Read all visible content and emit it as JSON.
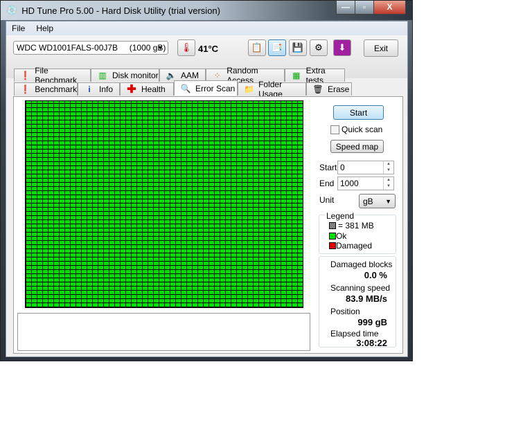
{
  "window": {
    "title": "HD Tune Pro 5.00 - Hard Disk Utility (trial version)",
    "minimize": "—",
    "maximize": "▫",
    "close": "X"
  },
  "menu": {
    "file": "File",
    "help": "Help"
  },
  "toolbar": {
    "drive": "WDC WD1001FALS-00J7B     (1000 gB)",
    "temperature": "41°C",
    "exit": "Exit"
  },
  "tabs_top": [
    "File Benchmark",
    "Disk monitor",
    "AAM",
    "Random Access",
    "Extra tests"
  ],
  "tabs_bottom": [
    "Benchmark",
    "Info",
    "Health",
    "Error Scan",
    "Folder Usage",
    "Erase"
  ],
  "active_tab": "Error Scan",
  "scan": {
    "start_button": "Start",
    "quick_scan_label": "Quick scan",
    "quick_scan_checked": false,
    "speed_map_button": "Speed map",
    "start_label": "Start",
    "start_value": "0",
    "end_label": "End",
    "end_value": "1000",
    "unit_label": "Unit",
    "unit_value": "gB"
  },
  "legend": {
    "title": "Legend",
    "block": "= 381 MB",
    "ok": "Ok",
    "damaged": "Damaged",
    "colors": {
      "block": "#808080",
      "ok": "#00e000",
      "damaged": "#e00000"
    }
  },
  "stats": {
    "damaged_label": "Damaged blocks",
    "damaged_value": "0.0 %",
    "speed_label": "Scanning speed",
    "speed_value": "83.9 MB/s",
    "position_label": "Position",
    "position_value": "999 gB",
    "elapsed_label": "Elapsed time",
    "elapsed_value": "3:08:22"
  }
}
